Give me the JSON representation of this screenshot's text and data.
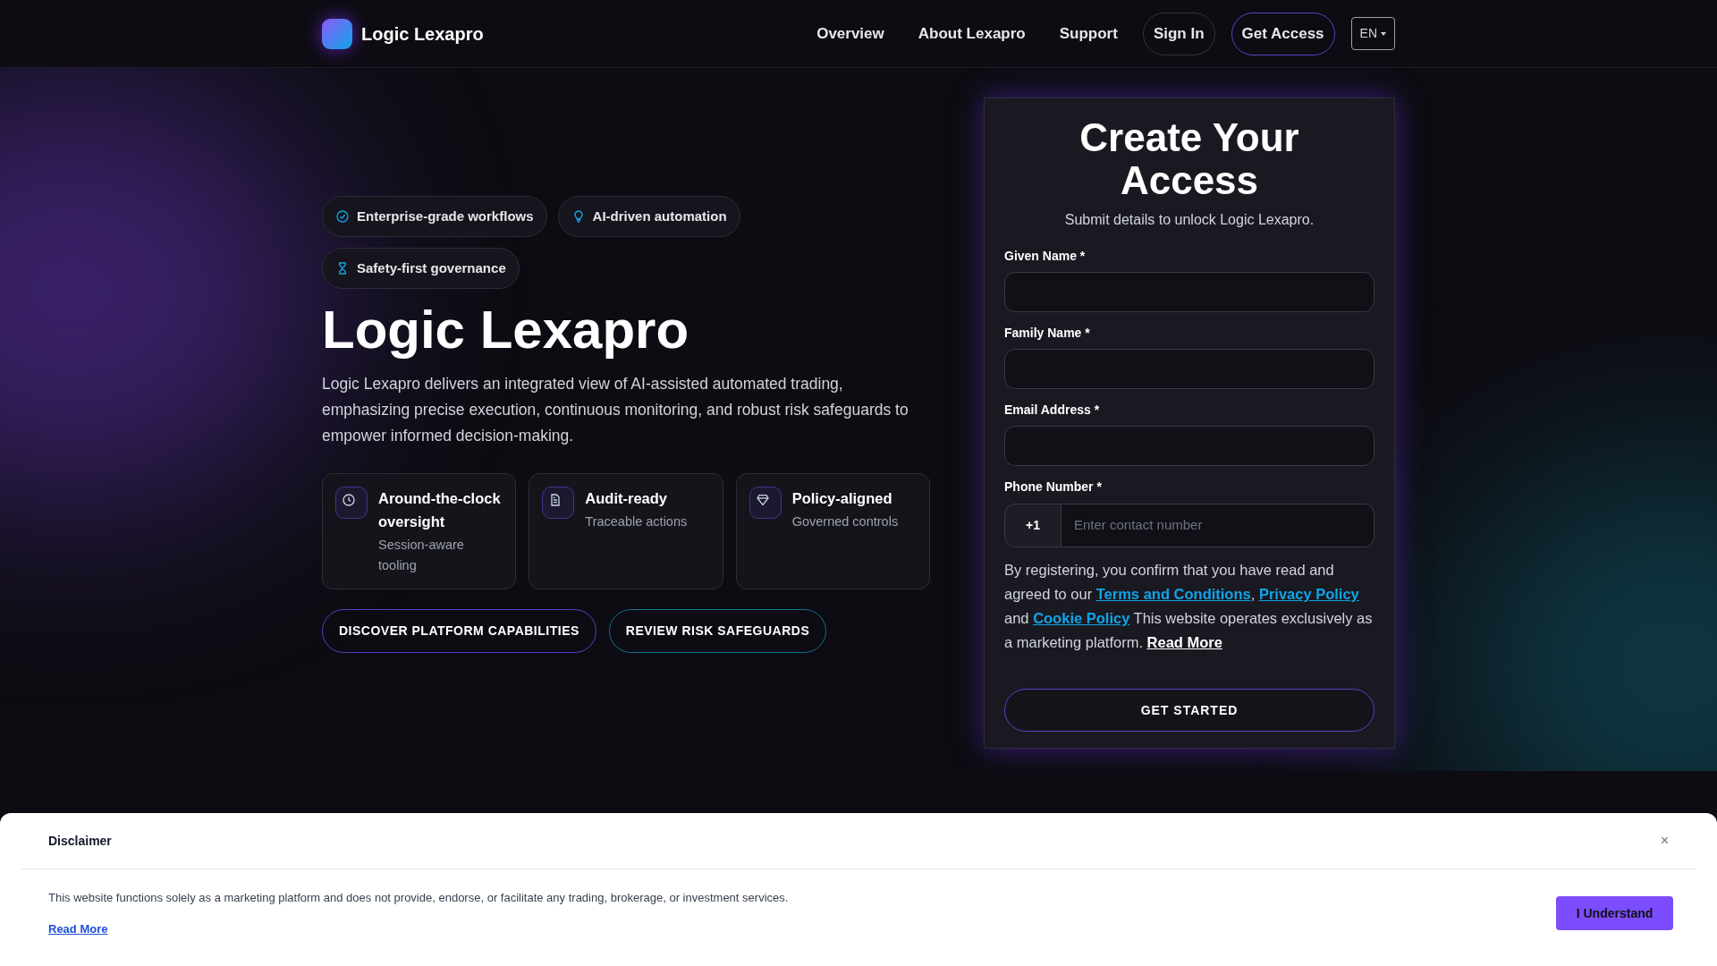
{
  "header": {
    "brand": "Logic Lexapro",
    "nav": [
      "Overview",
      "About Lexapro",
      "Support"
    ],
    "sign_in": "Sign In",
    "get_access": "Get Access",
    "language": "EN"
  },
  "hero": {
    "badges": [
      {
        "kind": "check",
        "label": "Enterprise-grade workflows"
      },
      {
        "kind": "bulb",
        "label": "AI-driven automation"
      },
      {
        "kind": "hourglass",
        "label": "Safety-first governance"
      }
    ],
    "title": "Logic Lexapro",
    "description": "Logic Lexapro delivers an integrated view of AI-assisted automated trading, emphasizing precise execution, continuous monitoring, and robust risk safeguards to empower informed decision-making.",
    "features": [
      {
        "kind": "clock",
        "title": "Around-the-clock oversight",
        "subtitle": "Session-aware tooling"
      },
      {
        "kind": "document",
        "title": "Audit-ready",
        "subtitle": "Traceable actions"
      },
      {
        "kind": "diamond",
        "title": "Policy-aligned",
        "subtitle": "Governed controls"
      }
    ],
    "buttons": [
      {
        "kind": "primary",
        "label": "DISCOVER PLATFORM CAPABILITIES"
      },
      {
        "kind": "secondary",
        "label": "REVIEW RISK SAFEGUARDS"
      }
    ]
  },
  "form": {
    "title": "Create Your Access",
    "subtitle": "Submit details to unlock Logic Lexapro.",
    "fields": [
      {
        "label": "Given Name *"
      },
      {
        "label": "Family Name *"
      },
      {
        "label": "Email Address *"
      }
    ],
    "phone": {
      "label": "Phone Number *",
      "code": "+1",
      "placeholder": "Enter contact number"
    },
    "consent": [
      {
        "kind": "text",
        "text": "By registering, you confirm that you have read and agreed to our "
      },
      {
        "kind": "link",
        "text": "Terms and Conditions"
      },
      {
        "kind": "text",
        "text": ", "
      },
      {
        "kind": "link",
        "text": "Privacy Policy"
      },
      {
        "kind": "text",
        "text": " and "
      },
      {
        "kind": "link",
        "text": "Cookie Policy"
      },
      {
        "kind": "text",
        "text": " This website operates exclusively as a marketing platform. "
      },
      {
        "kind": "more",
        "text": "Read More"
      }
    ],
    "submit": "GET STARTED"
  },
  "disclaimer": {
    "title": "Disclaimer",
    "close": "×",
    "text": "This website functions solely as a marketing platform and does not provide, endorse, or facilitate any trading, brokerage, or investment services.",
    "link": "Read More",
    "button": "I Understand"
  }
}
